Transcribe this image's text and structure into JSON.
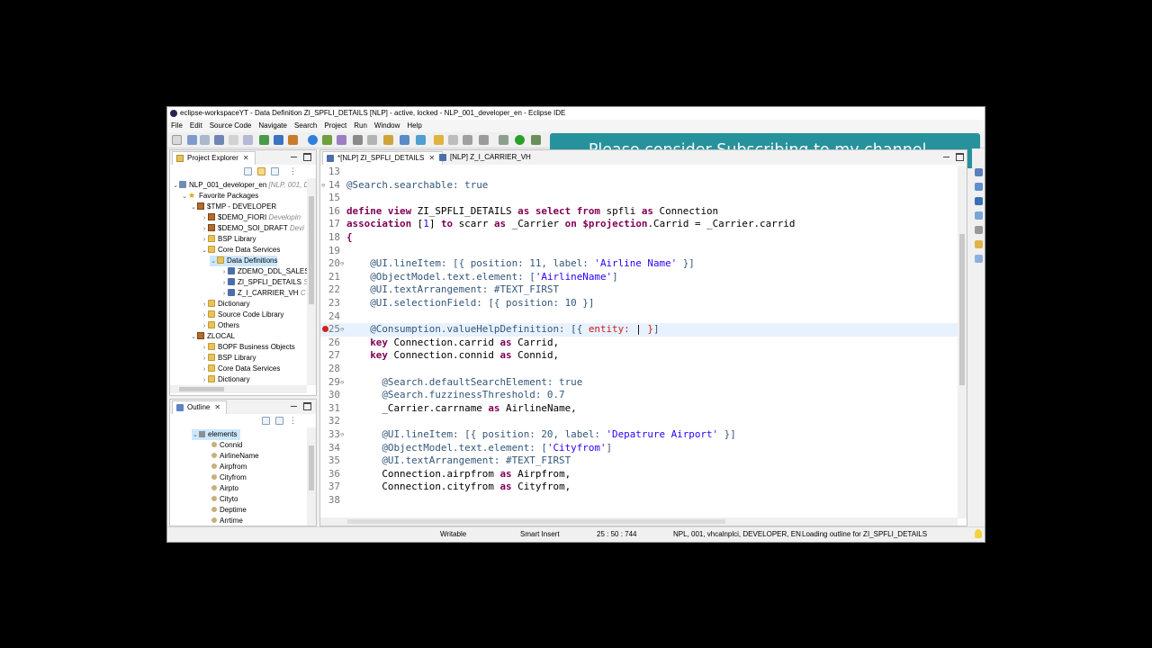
{
  "window": {
    "title": "eclipse-workspaceYT - Data Definition ZI_SPFLI_DETAILS [NLP]  - active, locked - NLP_001_developer_en - Eclipse IDE"
  },
  "banner": {
    "text": "Please consider Subscribing to my channel..."
  },
  "menu": [
    "File",
    "Edit",
    "Source Code",
    "Navigate",
    "Search",
    "Project",
    "Run",
    "Window",
    "Help"
  ],
  "project_explorer": {
    "tab_label": "Project Explorer",
    "tree": [
      {
        "label": "NLP_001_developer_en",
        "deco": "[NLP, 001, D",
        "icon": "project-icon"
      },
      {
        "label": "Favorite Packages",
        "icon": "star-icon"
      },
      {
        "label": "$TMP - DEVELOPER",
        "icon": "package-icon"
      },
      {
        "label": "$DEMO_FIORI",
        "deco": "Developin",
        "icon": "package-icon"
      },
      {
        "label": "$DEMO_SOI_DRAFT",
        "deco": "Devi",
        "icon": "package-icon"
      },
      {
        "label": "BSP Library",
        "icon": "folder-icon"
      },
      {
        "label": "Core Data Services",
        "icon": "folder-icon"
      },
      {
        "label": "Data Definitions",
        "icon": "folder-icon"
      },
      {
        "label": "ZDEMO_DDL_SALES",
        "icon": "ddl-icon"
      },
      {
        "label": "ZI_SPFLI_DETAILS",
        "deco": "S",
        "icon": "ddl-icon"
      },
      {
        "label": "Z_I_CARRIER_VH",
        "deco": "C",
        "icon": "ddl-icon"
      },
      {
        "label": "Dictionary",
        "icon": "folder-icon"
      },
      {
        "label": "Source Code Library",
        "icon": "folder-icon"
      },
      {
        "label": "Others",
        "icon": "folder-icon"
      },
      {
        "label": "ZLOCAL",
        "icon": "package-icon"
      },
      {
        "label": "BOPF Business Objects",
        "icon": "folder-icon"
      },
      {
        "label": "BSP Library",
        "icon": "folder-icon"
      },
      {
        "label": "Core Data Services",
        "icon": "folder-icon"
      },
      {
        "label": "Dictionary",
        "icon": "folder-icon"
      }
    ]
  },
  "outline": {
    "tab_label": "Outline",
    "root": "elements",
    "items": [
      "Connid",
      "AirlineName",
      "Airpfrom",
      "Cityfrom",
      "Airpto",
      "Cityto",
      "Deptime",
      "Arrtime"
    ]
  },
  "editor": {
    "tabs": [
      "*[NLP] ZI_SPFLI_DETAILS",
      "[NLP] Z_I_CARRIER_VH"
    ],
    "lines": [
      {
        "n": "13",
        "text": ""
      },
      {
        "n": "14",
        "text": "@Search.searchable: true"
      },
      {
        "n": "15",
        "text": ""
      },
      {
        "n": "16",
        "text": "define view ZI_SPFLI_DETAILS as select from spfli as Connection"
      },
      {
        "n": "17",
        "text": "association [1] to scarr as _Carrier on $projection.Carrid = _Carrier.carrid"
      },
      {
        "n": "18",
        "text": "{"
      },
      {
        "n": "19",
        "text": ""
      },
      {
        "n": "20",
        "text": "    @UI.lineItem: [{ position: 11, label: 'Airline Name' }]"
      },
      {
        "n": "21",
        "text": "    @ObjectModel.text.element: ['AirlineName']"
      },
      {
        "n": "22",
        "text": "    @UI.textArrangement: #TEXT_FIRST"
      },
      {
        "n": "23",
        "text": "    @UI.selectionField: [{ position: 10 }]"
      },
      {
        "n": "24",
        "text": ""
      },
      {
        "n": "25",
        "text": "    @Consumption.valueHelpDefinition: [{ entity: | }]"
      },
      {
        "n": "26",
        "text": "    key Connection.carrid as Carrid,"
      },
      {
        "n": "27",
        "text": "    key Connection.connid as Connid,"
      },
      {
        "n": "28",
        "text": ""
      },
      {
        "n": "29",
        "text": "      @Search.defaultSearchElement: true"
      },
      {
        "n": "30",
        "text": "      @Search.fuzzinessThreshold: 0.7"
      },
      {
        "n": "31",
        "text": "      _Carrier.carrname as AirlineName,"
      },
      {
        "n": "32",
        "text": ""
      },
      {
        "n": "33",
        "text": "      @UI.lineItem: [{ position: 20, label: 'Depatrure Airport' }]"
      },
      {
        "n": "34",
        "text": "      @ObjectModel.text.element: ['Cityfrom']"
      },
      {
        "n": "35",
        "text": "      @UI.textArrangement: #TEXT_FIRST"
      },
      {
        "n": "36",
        "text": "      Connection.airpfrom as Airpfrom,"
      },
      {
        "n": "37",
        "text": "      Connection.cityfrom as Cityfrom,"
      },
      {
        "n": "38",
        "text": ""
      }
    ]
  },
  "status_bar": {
    "mode": "Writable",
    "insert": "Smart Insert",
    "position": "25 : 50 : 744",
    "system": "NPL, 001, vhcalnplci, DEVELOPER, EN",
    "job": "Loading outline for ZI_SPFLI_DETAILS"
  },
  "colors": {
    "banner_bg": "#26929c",
    "keyword": "#7f0055",
    "annotation": "#33577a",
    "string": "#2a00ff"
  }
}
